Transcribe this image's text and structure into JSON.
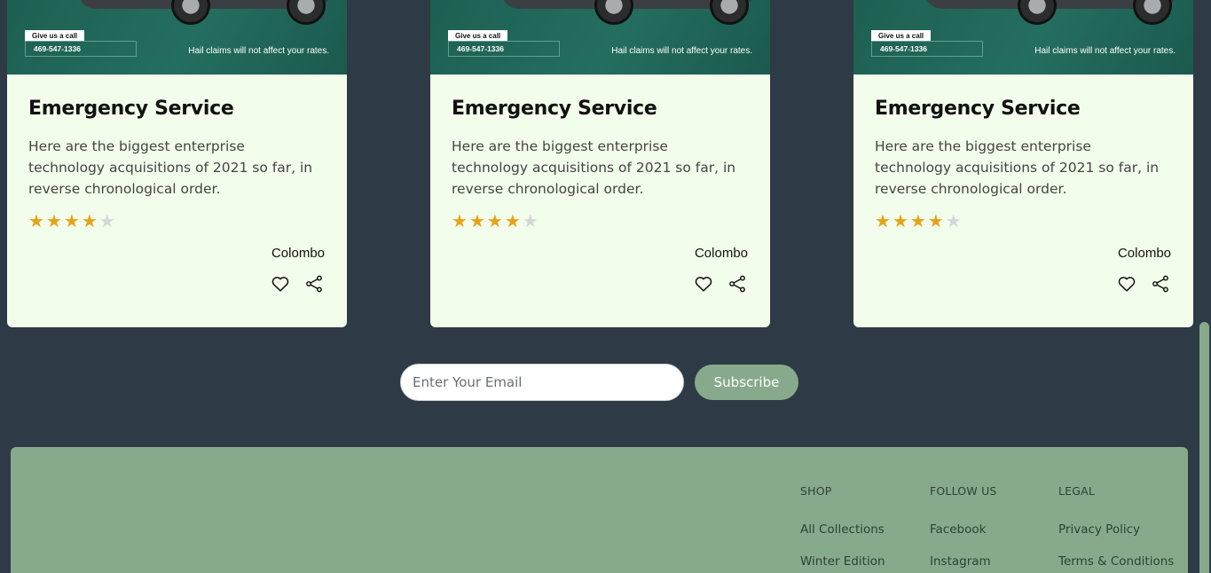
{
  "cards": [
    {
      "promo_badge": "Give us a call",
      "promo_phone": "469-547-1336",
      "promo_note": "Hail claims will not affect your rates.",
      "title": "Emergency Service",
      "description": "Here are the biggest enterprise technology acquisitions of 2021 so far, in reverse chronological order.",
      "rating": 4,
      "rating_max": 5,
      "location": "Colombo"
    },
    {
      "promo_badge": "Give us a call",
      "promo_phone": "469-547-1336",
      "promo_note": "Hail claims will not affect your rates.",
      "title": "Emergency Service",
      "description": "Here are the biggest enterprise technology acquisitions of 2021 so far, in reverse chronological order.",
      "rating": 4,
      "rating_max": 5,
      "location": "Colombo"
    },
    {
      "promo_badge": "Give us a call",
      "promo_phone": "469-547-1336",
      "promo_note": "Hail claims will not affect your rates.",
      "title": "Emergency Service",
      "description": "Here are the biggest enterprise technology acquisitions of 2021 so far, in reverse chronological order.",
      "rating": 4,
      "rating_max": 5,
      "location": "Colombo"
    }
  ],
  "icons": {
    "like": "heart-icon",
    "share": "share-icon",
    "star": "star-icon"
  },
  "subscribe": {
    "placeholder": "Enter Your Email",
    "value": "",
    "button_label": "Subscribe"
  },
  "footer": {
    "columns": [
      {
        "heading": "SHOP",
        "links": [
          "All Collections",
          "Winter Edition"
        ]
      },
      {
        "heading": "FOLLOW US",
        "links": [
          "Facebook",
          "Instagram"
        ]
      },
      {
        "heading": "LEGAL",
        "links": [
          "Privacy Policy",
          "Terms & Conditions"
        ]
      }
    ]
  },
  "colors": {
    "page_background": "#2e3a45",
    "card_background": "#f3fdeb",
    "accent_green": "#87aa8c",
    "banner_green": "#1d5f52",
    "star_filled": "#e6a317",
    "star_empty": "#d4d6da"
  }
}
